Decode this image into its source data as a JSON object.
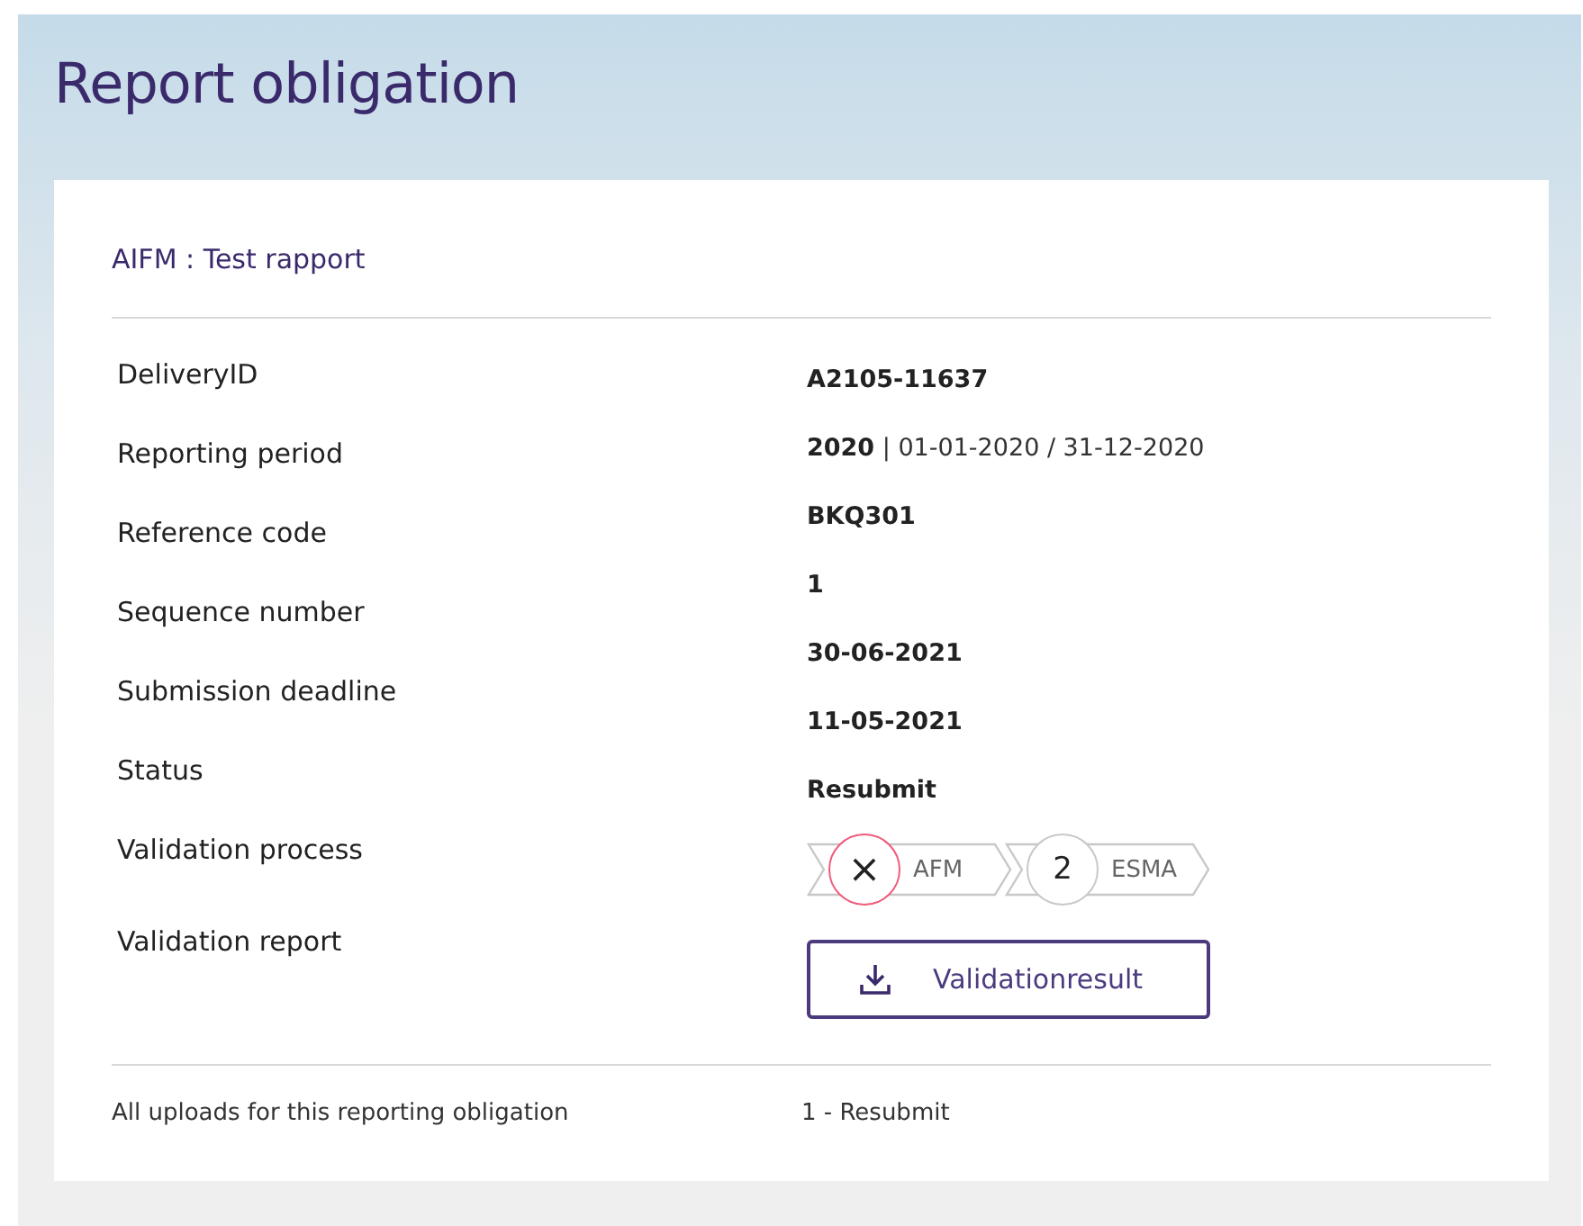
{
  "page": {
    "title": "Report obligation"
  },
  "card": {
    "heading": "AIFM : Test rapport",
    "labels": [
      "DeliveryID",
      "Reporting period",
      "Reference code",
      "Sequence number",
      "Submission deadline",
      "Status",
      "Validation process",
      "Validation report"
    ],
    "values": [
      {
        "kind": "text",
        "text": "**A2105-11637**"
      },
      {
        "kind": "text",
        "text": "**2020** | 01-01-2020 / 31-12-2020"
      },
      {
        "kind": "text",
        "text": "**BKQ301**"
      },
      {
        "kind": "text",
        "text": "**1**"
      },
      {
        "kind": "text",
        "text": "**30-06-2021**"
      },
      {
        "kind": "text",
        "text": "**11-05-2021**"
      },
      {
        "kind": "text",
        "text": "**Resubmit**"
      },
      {
        "kind": "steps",
        "steps": [
          {
            "mark": "×",
            "label": "AFM",
            "failed": true
          },
          {
            "mark": "2",
            "label": "ESMA",
            "failed": false
          }
        ]
      },
      {
        "kind": "button",
        "label": "Validationresult"
      }
    ],
    "footer": {
      "label": "All uploads for this reporting obligation",
      "value": "1 - Resubmit"
    }
  }
}
